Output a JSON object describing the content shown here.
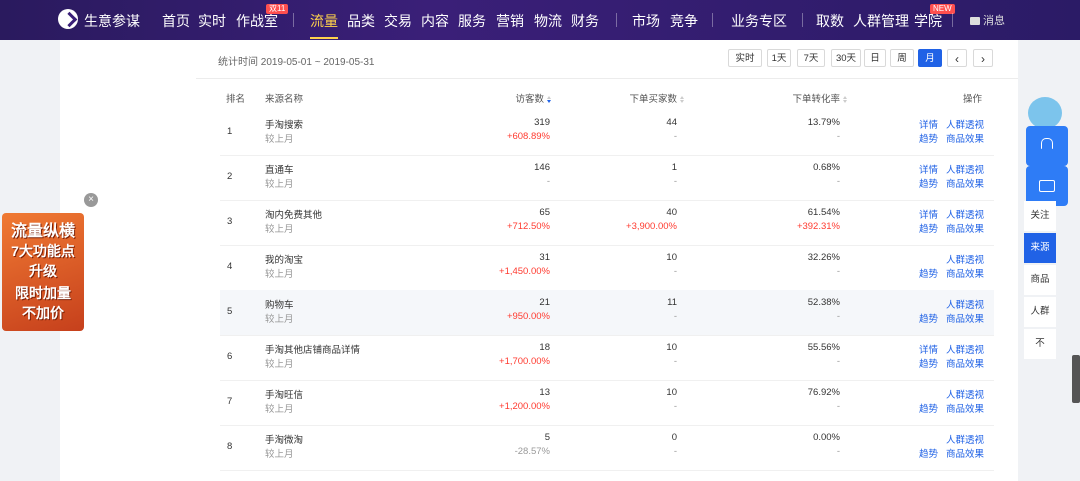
{
  "app": {
    "brand": "生意参谋"
  },
  "nav": [
    {
      "label": "首页"
    },
    {
      "label": "实时"
    },
    {
      "label": "作战室",
      "badge": "双11"
    },
    {
      "label": "流量",
      "active": true
    },
    {
      "label": "品类"
    },
    {
      "label": "交易"
    },
    {
      "label": "内容"
    },
    {
      "label": "服务"
    },
    {
      "label": "营销"
    },
    {
      "label": "物流"
    },
    {
      "label": "财务"
    },
    {
      "label": "市场"
    },
    {
      "label": "竞争"
    },
    {
      "label": "业务专区"
    },
    {
      "label": "取数"
    },
    {
      "label": "人群管理"
    },
    {
      "label": "学院",
      "badge": "NEW"
    }
  ],
  "message": "消息",
  "filter": {
    "stat_time": "统计时间 2019-05-01 ~ 2019-05-31",
    "buttons": [
      "实时",
      "1天",
      "7天",
      "30天",
      "日",
      "周",
      "月"
    ],
    "active": "月",
    "prev": "‹",
    "next": "›"
  },
  "table": {
    "headers": {
      "rank": "排名",
      "source": "来源名称",
      "visitors": "访客数",
      "buyers": "下单买家数",
      "conversion": "下单转化率",
      "ops": "操作"
    },
    "compare_label": "较上月",
    "rows": [
      {
        "rank": "1",
        "name": "手淘搜索",
        "visitors": "319",
        "visitors_chg": "+608.89%",
        "buyers": "44",
        "buyers_chg": "-",
        "conv": "13.79%",
        "conv_chg": "-",
        "detail": "详情",
        "trend": "趋势",
        "crowd": "人群透视",
        "goods": "商品效果"
      },
      {
        "rank": "2",
        "name": "直通车",
        "visitors": "146",
        "visitors_chg": "-",
        "buyers": "1",
        "buyers_chg": "-",
        "conv": "0.68%",
        "conv_chg": "-",
        "detail": "详情",
        "trend": "趋势",
        "crowd": "人群透视",
        "goods": "商品效果"
      },
      {
        "rank": "3",
        "name": "淘内免费其他",
        "visitors": "65",
        "visitors_chg": "+712.50%",
        "buyers": "40",
        "buyers_chg": "+3,900.00%",
        "conv": "61.54%",
        "conv_chg": "+392.31%",
        "detail": "详情",
        "trend": "趋势",
        "crowd": "人群透视",
        "goods": "商品效果"
      },
      {
        "rank": "4",
        "name": "我的淘宝",
        "visitors": "31",
        "visitors_chg": "+1,450.00%",
        "buyers": "10",
        "buyers_chg": "-",
        "conv": "32.26%",
        "conv_chg": "-",
        "detail": "",
        "trend": "趋势",
        "crowd": "人群透视",
        "goods": "商品效果"
      },
      {
        "rank": "5",
        "name": "购物车",
        "visitors": "21",
        "visitors_chg": "+950.00%",
        "buyers": "11",
        "buyers_chg": "-",
        "conv": "52.38%",
        "conv_chg": "-",
        "detail": "",
        "trend": "趋势",
        "crowd": "人群透视",
        "goods": "商品效果"
      },
      {
        "rank": "6",
        "name": "手淘其他店铺商品详情",
        "visitors": "18",
        "visitors_chg": "+1,700.00%",
        "buyers": "10",
        "buyers_chg": "-",
        "conv": "55.56%",
        "conv_chg": "-",
        "detail": "详情",
        "trend": "趋势",
        "crowd": "人群透视",
        "goods": "商品效果"
      },
      {
        "rank": "7",
        "name": "手淘旺信",
        "visitors": "13",
        "visitors_chg": "+1,200.00%",
        "buyers": "10",
        "buyers_chg": "-",
        "conv": "76.92%",
        "conv_chg": "-",
        "detail": "",
        "trend": "趋势",
        "crowd": "人群透视",
        "goods": "商品效果"
      },
      {
        "rank": "8",
        "name": "手淘微淘",
        "visitors": "5",
        "visitors_chg": "-28.57%",
        "buyers": "0",
        "buyers_chg": "-",
        "conv": "0.00%",
        "conv_chg": "-",
        "detail": "",
        "trend": "趋势",
        "crowd": "人群透视",
        "goods": "商品效果"
      }
    ]
  },
  "promo": {
    "lines": [
      "流量纵横",
      "7大功能点",
      "升级",
      "限时加量",
      "不加价"
    ],
    "close": "×"
  },
  "side_tabs": [
    {
      "label": "关注"
    },
    {
      "label": "来源",
      "active": true
    },
    {
      "label": "商品"
    },
    {
      "label": "人群"
    },
    {
      "label": "不"
    }
  ]
}
